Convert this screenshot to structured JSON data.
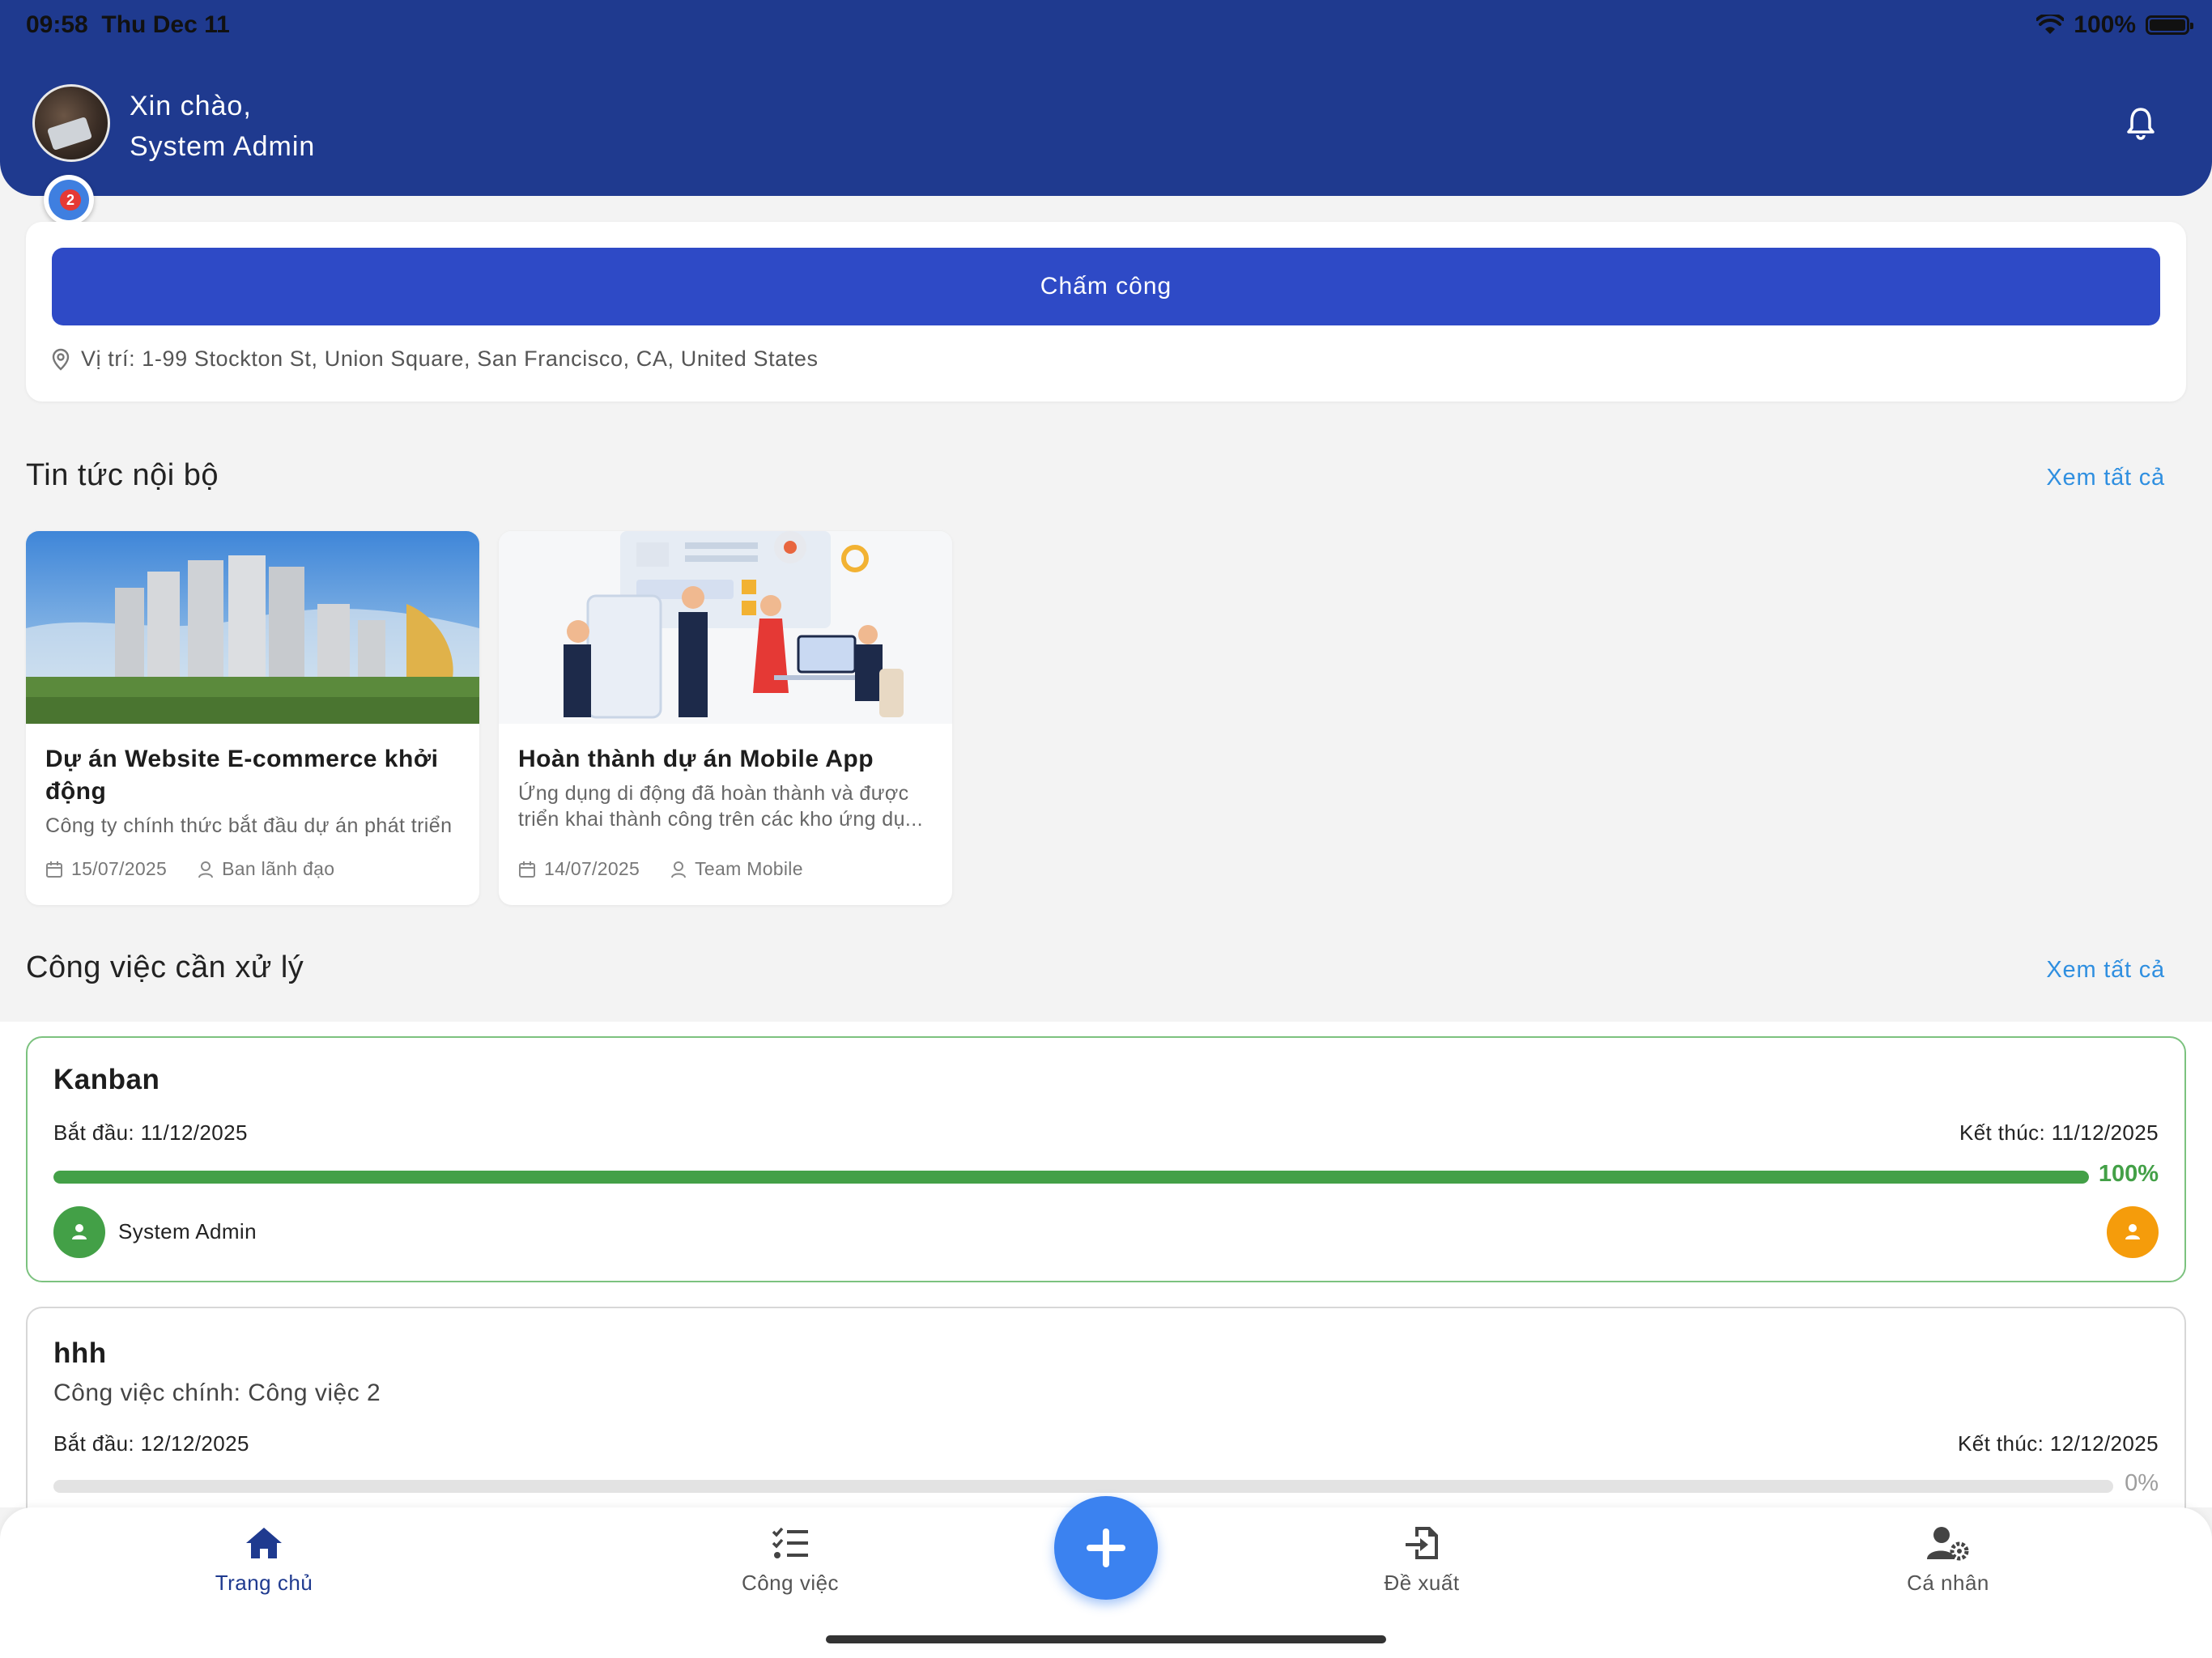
{
  "status_bar": {
    "time": "09:58",
    "date": "Thu Dec 11",
    "battery": "100%"
  },
  "header": {
    "greeting": "Xin chào,",
    "user_name": "System Admin",
    "bug_count": "2",
    "colors": {
      "primary": "#1f3a8f"
    }
  },
  "checkin": {
    "button_label": "Chấm công",
    "location": "Vị trí: 1-99 Stockton St, Union Square, San Francisco, CA, United States"
  },
  "news": {
    "title": "Tin tức nội bộ",
    "see_all": "Xem tất cả",
    "items": [
      {
        "title": "Dự án Website E-commerce khởi động",
        "desc": "Công ty chính thức bắt đầu dự án phát triển website thương mại điện tử mới",
        "date": "15/07/2025",
        "author": "Ban lãnh đạo"
      },
      {
        "title": "Hoàn thành dự án Mobile App",
        "desc": "Ứng dụng di động đã hoàn thành và được triển khai thành công trên các kho ứng dụ...",
        "date": "14/07/2025",
        "author": "Team Mobile"
      }
    ]
  },
  "tasks": {
    "title": "Công việc cần xử lý",
    "see_all": "Xem tất cả",
    "items": [
      {
        "title": "Kanban",
        "start": "Bắt đầu: 11/12/2025",
        "end": "Kết thúc: 11/12/2025",
        "progress": 100,
        "progress_label": "100%",
        "assignee": "System Admin",
        "color": "#43a047"
      },
      {
        "title": "hhh",
        "parent": "Công việc chính: Công việc 2",
        "start": "Bắt đầu: 12/12/2025",
        "end": "Kết thúc: 12/12/2025",
        "progress": 0,
        "progress_label": "0%",
        "color": "#9e9e9e"
      }
    ]
  },
  "nav": {
    "items": [
      {
        "label": "Trang chủ",
        "icon": "home-icon",
        "active": true
      },
      {
        "label": "Công việc",
        "icon": "checklist-icon"
      },
      {
        "label": "Đề xuất",
        "icon": "file-import-icon"
      },
      {
        "label": "Cá nhân",
        "icon": "user-gear-icon"
      }
    ],
    "fab_icon": "plus-icon"
  }
}
